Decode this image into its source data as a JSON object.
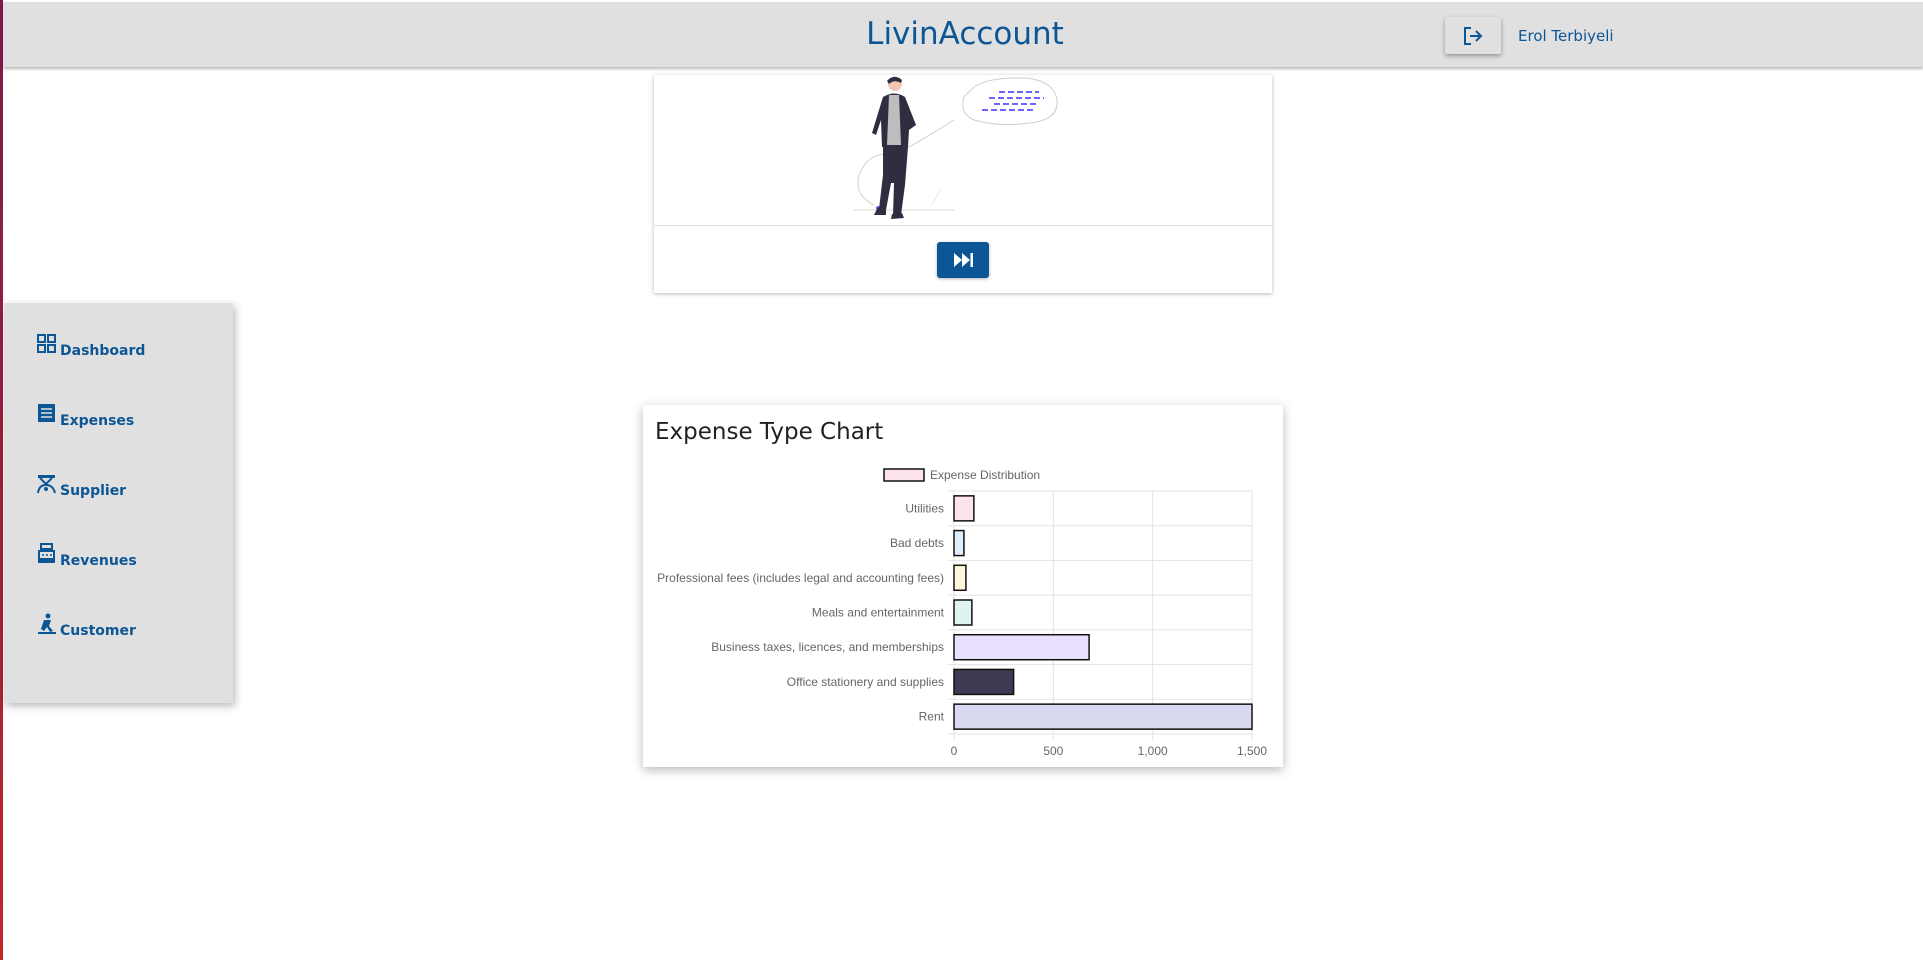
{
  "header": {
    "app_title": "LivinAccount",
    "user_name": "Erol Terbiyeli",
    "logout_icon": "logout-icon"
  },
  "hero": {
    "skip_icon": "fast-forward-icon"
  },
  "sidebar": {
    "items": [
      {
        "label": "Dashboard",
        "icon": "dashboard-icon"
      },
      {
        "label": "Expenses",
        "icon": "receipt-icon"
      },
      {
        "label": "Supplier",
        "icon": "supplier-icon"
      },
      {
        "label": "Revenues",
        "icon": "cash-register-icon"
      },
      {
        "label": "Customer",
        "icon": "customer-icon"
      }
    ]
  },
  "colors": {
    "brand_blue": "#0d5696",
    "header_bg": "#e0e0e0"
  },
  "chart_data": {
    "type": "bar",
    "orientation": "horizontal",
    "title": "Expense Type Chart",
    "legend": "Expense Distribution",
    "legend_position": "top",
    "categories": [
      "Utilities",
      "Bad debts",
      "Professional fees (includes legal and accounting fees)",
      "Meals and entertainment",
      "Business taxes, licences, and memberships",
      "Office stationery and supplies",
      "Rent"
    ],
    "series": [
      {
        "name": "Expense Distribution",
        "values": [
          100,
          50,
          60,
          90,
          680,
          300,
          1500
        ],
        "colors": [
          "#fde4ea",
          "#deeefa",
          "#fff5dc",
          "#dff3f0",
          "#e9e1ff",
          "#3c3b53",
          "#d7d9f0"
        ]
      }
    ],
    "xlim": [
      0,
      1500
    ],
    "x_ticks": [
      "0",
      "500",
      "1,000",
      "1,500"
    ],
    "x_tick_values": [
      0,
      500,
      1000,
      1500
    ],
    "grid": true
  }
}
